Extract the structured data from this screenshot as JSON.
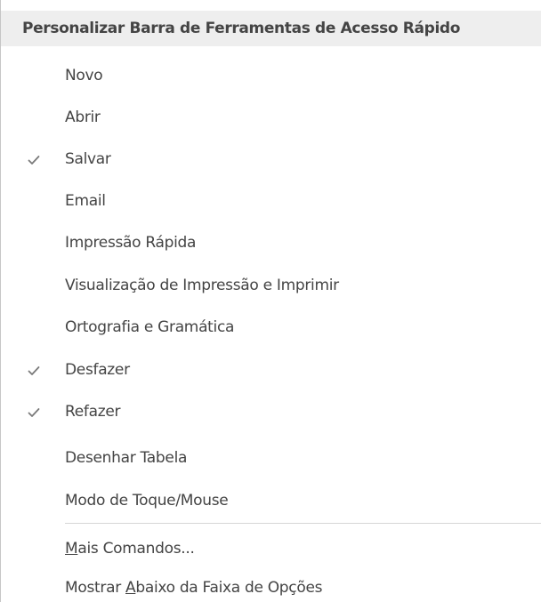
{
  "menu": {
    "title": "Personalizar Barra de Ferramentas de Acesso Rápido",
    "items": [
      {
        "label": "Novo",
        "checked": false
      },
      {
        "label": "Abrir",
        "checked": false
      },
      {
        "label": "Salvar",
        "checked": true
      },
      {
        "label": "Email",
        "checked": false
      },
      {
        "label": "Impressão Rápida",
        "checked": false
      },
      {
        "label": "Visualização de Impressão e Imprimir",
        "checked": false
      },
      {
        "label": "Ortografia e Gramática",
        "checked": false
      },
      {
        "label": "Desfazer",
        "checked": true
      },
      {
        "label": "Refazer",
        "checked": true
      },
      {
        "label": "Desenhar Tabela",
        "checked": false
      },
      {
        "label": "Modo de Toque/Mouse",
        "checked": false
      }
    ],
    "more_commands": {
      "pre": "",
      "mnemonic": "M",
      "post": "ais Comandos..."
    },
    "show_below": {
      "pre": "Mostrar ",
      "mnemonic": "A",
      "post": "baixo da Faixa de Opções"
    }
  },
  "icons": {
    "check": "checkmark-icon"
  },
  "colors": {
    "header_bg": "#eeeeee",
    "text": "#444444",
    "check": "#7a7a7a",
    "separator": "#d6d6d6"
  }
}
